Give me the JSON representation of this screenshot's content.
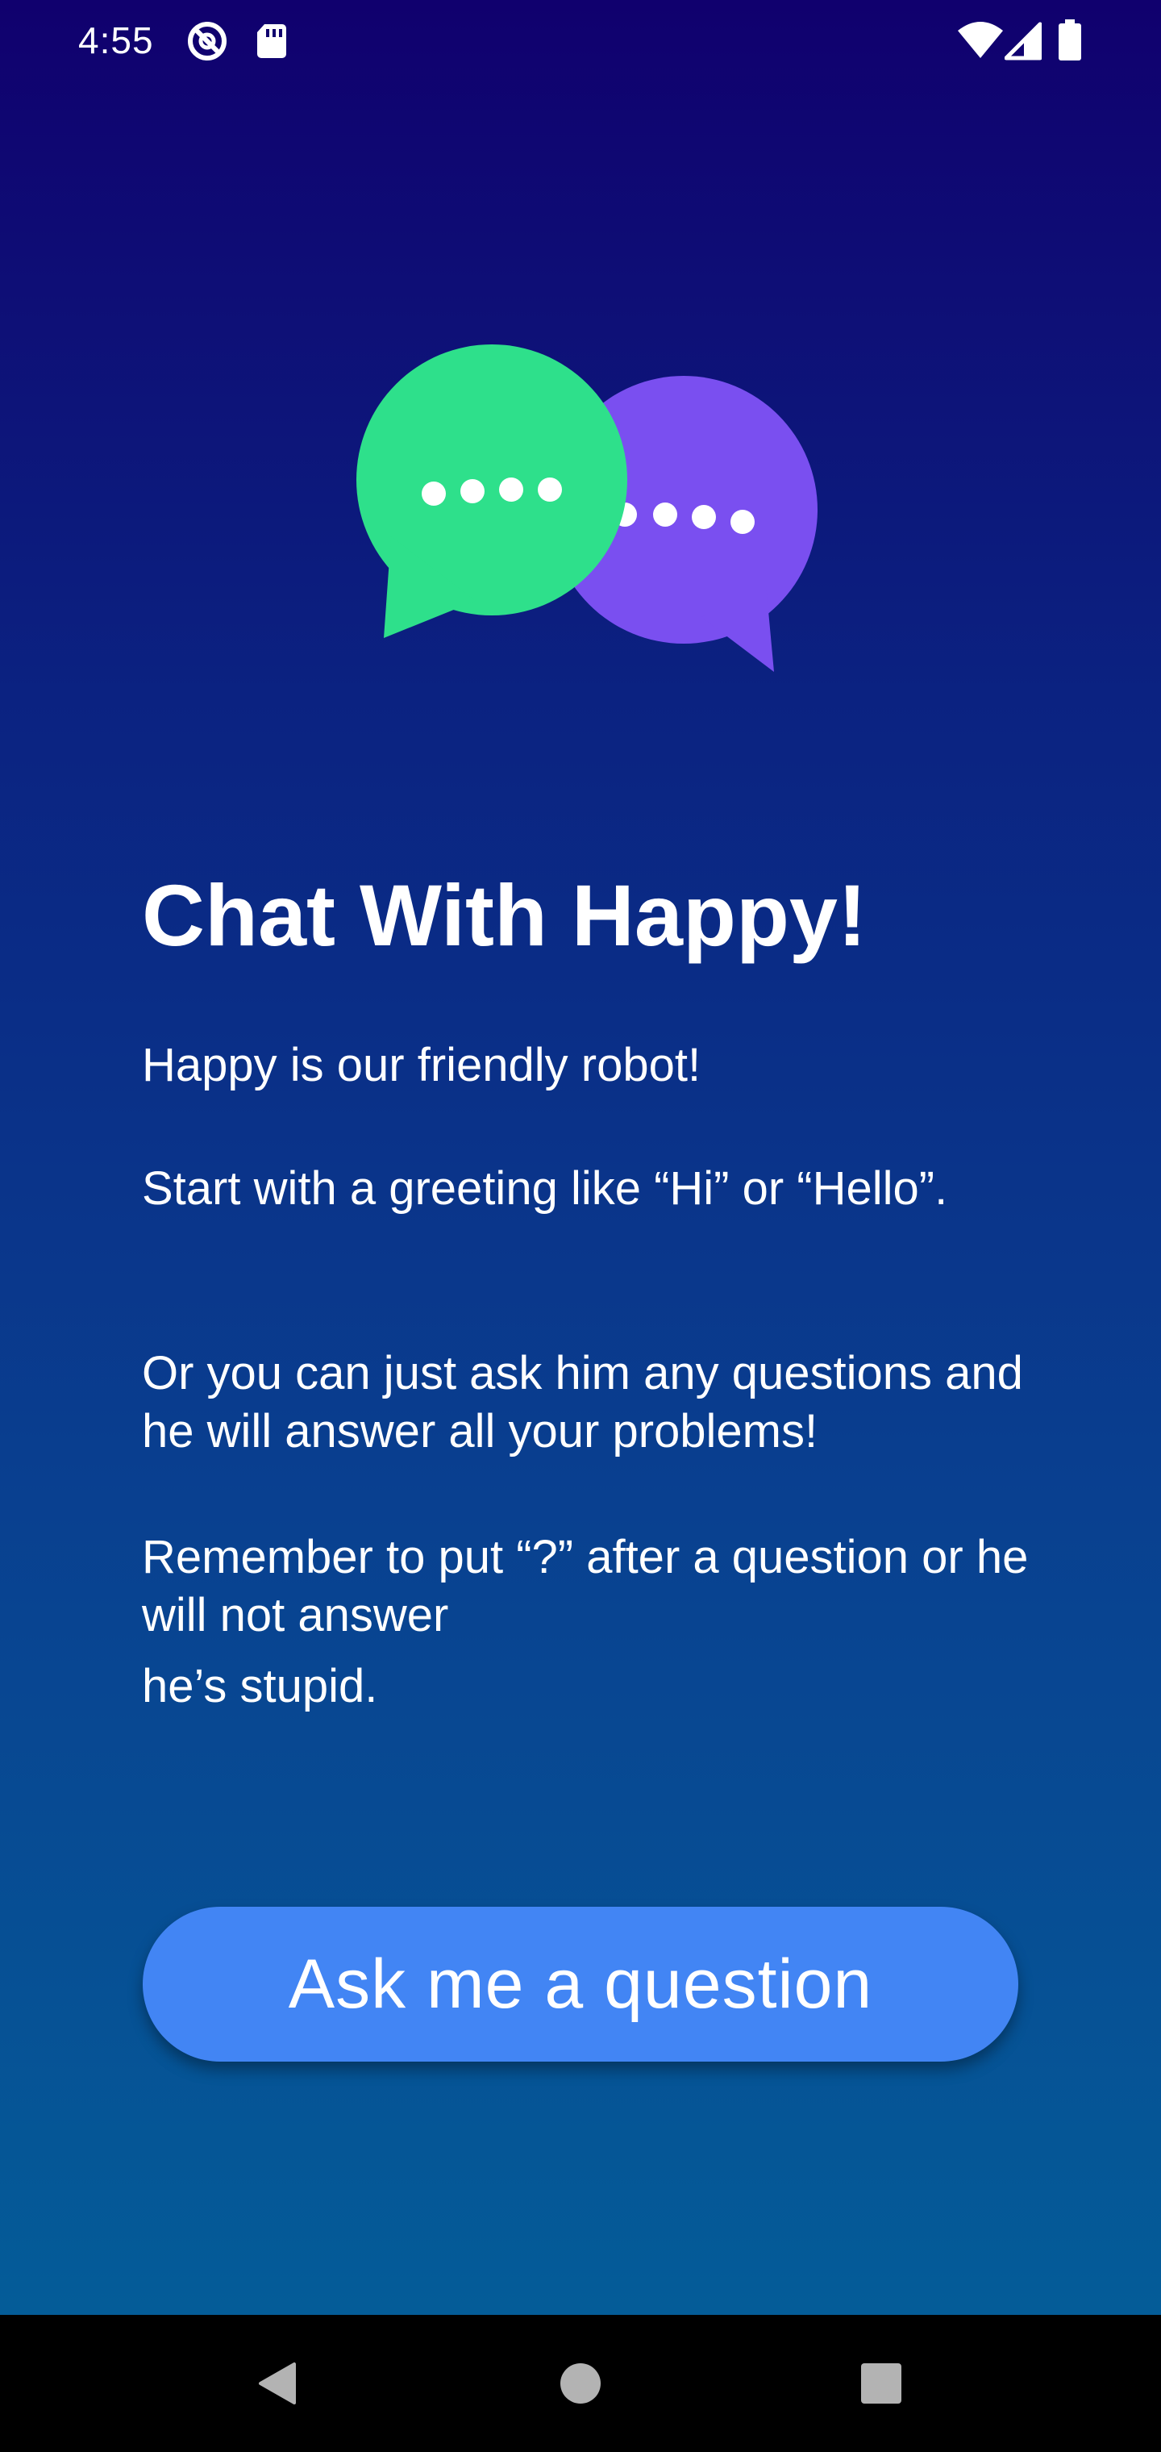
{
  "status_bar": {
    "time": "4:55",
    "left_icons": [
      "at-sign-icon",
      "sd-card-icon"
    ],
    "right_icons": [
      "wifi-icon",
      "signal-icon",
      "battery-icon"
    ]
  },
  "illustration": {
    "icon": "chat-bubbles-icon",
    "colors": {
      "green_bubble": "#2ee08b",
      "purple_bubble": "#7a4ff0"
    }
  },
  "content": {
    "title": "Chat With Happy!",
    "paragraphs": [
      "Happy is our friendly robot!",
      "Start with a greeting like “Hi” or “Hello”.",
      "Or you can just ask him any questions and he will answer all your problems!",
      "Remember to put “?” after a question or he will not answer",
      "he’s stupid."
    ]
  },
  "actions": {
    "ask_button_label": "Ask me a question",
    "button_color": "#4285f4"
  },
  "nav_bar": {
    "buttons": [
      "back-icon",
      "home-icon",
      "recents-icon"
    ]
  }
}
